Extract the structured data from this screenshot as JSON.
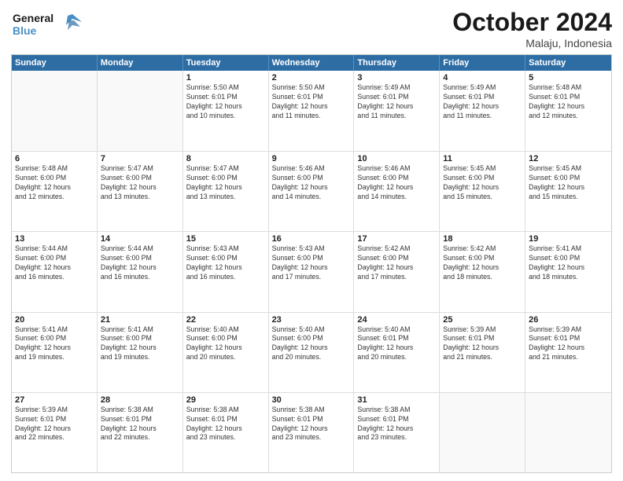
{
  "logo": {
    "line1": "General",
    "line2": "Blue"
  },
  "header": {
    "month": "October 2024",
    "location": "Malaju, Indonesia"
  },
  "days_of_week": [
    "Sunday",
    "Monday",
    "Tuesday",
    "Wednesday",
    "Thursday",
    "Friday",
    "Saturday"
  ],
  "weeks": [
    [
      {
        "day": "",
        "info": ""
      },
      {
        "day": "",
        "info": ""
      },
      {
        "day": "1",
        "info": "Sunrise: 5:50 AM\nSunset: 6:01 PM\nDaylight: 12 hours\nand 10 minutes."
      },
      {
        "day": "2",
        "info": "Sunrise: 5:50 AM\nSunset: 6:01 PM\nDaylight: 12 hours\nand 11 minutes."
      },
      {
        "day": "3",
        "info": "Sunrise: 5:49 AM\nSunset: 6:01 PM\nDaylight: 12 hours\nand 11 minutes."
      },
      {
        "day": "4",
        "info": "Sunrise: 5:49 AM\nSunset: 6:01 PM\nDaylight: 12 hours\nand 11 minutes."
      },
      {
        "day": "5",
        "info": "Sunrise: 5:48 AM\nSunset: 6:01 PM\nDaylight: 12 hours\nand 12 minutes."
      }
    ],
    [
      {
        "day": "6",
        "info": "Sunrise: 5:48 AM\nSunset: 6:00 PM\nDaylight: 12 hours\nand 12 minutes."
      },
      {
        "day": "7",
        "info": "Sunrise: 5:47 AM\nSunset: 6:00 PM\nDaylight: 12 hours\nand 13 minutes."
      },
      {
        "day": "8",
        "info": "Sunrise: 5:47 AM\nSunset: 6:00 PM\nDaylight: 12 hours\nand 13 minutes."
      },
      {
        "day": "9",
        "info": "Sunrise: 5:46 AM\nSunset: 6:00 PM\nDaylight: 12 hours\nand 14 minutes."
      },
      {
        "day": "10",
        "info": "Sunrise: 5:46 AM\nSunset: 6:00 PM\nDaylight: 12 hours\nand 14 minutes."
      },
      {
        "day": "11",
        "info": "Sunrise: 5:45 AM\nSunset: 6:00 PM\nDaylight: 12 hours\nand 15 minutes."
      },
      {
        "day": "12",
        "info": "Sunrise: 5:45 AM\nSunset: 6:00 PM\nDaylight: 12 hours\nand 15 minutes."
      }
    ],
    [
      {
        "day": "13",
        "info": "Sunrise: 5:44 AM\nSunset: 6:00 PM\nDaylight: 12 hours\nand 16 minutes."
      },
      {
        "day": "14",
        "info": "Sunrise: 5:44 AM\nSunset: 6:00 PM\nDaylight: 12 hours\nand 16 minutes."
      },
      {
        "day": "15",
        "info": "Sunrise: 5:43 AM\nSunset: 6:00 PM\nDaylight: 12 hours\nand 16 minutes."
      },
      {
        "day": "16",
        "info": "Sunrise: 5:43 AM\nSunset: 6:00 PM\nDaylight: 12 hours\nand 17 minutes."
      },
      {
        "day": "17",
        "info": "Sunrise: 5:42 AM\nSunset: 6:00 PM\nDaylight: 12 hours\nand 17 minutes."
      },
      {
        "day": "18",
        "info": "Sunrise: 5:42 AM\nSunset: 6:00 PM\nDaylight: 12 hours\nand 18 minutes."
      },
      {
        "day": "19",
        "info": "Sunrise: 5:41 AM\nSunset: 6:00 PM\nDaylight: 12 hours\nand 18 minutes."
      }
    ],
    [
      {
        "day": "20",
        "info": "Sunrise: 5:41 AM\nSunset: 6:00 PM\nDaylight: 12 hours\nand 19 minutes."
      },
      {
        "day": "21",
        "info": "Sunrise: 5:41 AM\nSunset: 6:00 PM\nDaylight: 12 hours\nand 19 minutes."
      },
      {
        "day": "22",
        "info": "Sunrise: 5:40 AM\nSunset: 6:00 PM\nDaylight: 12 hours\nand 20 minutes."
      },
      {
        "day": "23",
        "info": "Sunrise: 5:40 AM\nSunset: 6:00 PM\nDaylight: 12 hours\nand 20 minutes."
      },
      {
        "day": "24",
        "info": "Sunrise: 5:40 AM\nSunset: 6:01 PM\nDaylight: 12 hours\nand 20 minutes."
      },
      {
        "day": "25",
        "info": "Sunrise: 5:39 AM\nSunset: 6:01 PM\nDaylight: 12 hours\nand 21 minutes."
      },
      {
        "day": "26",
        "info": "Sunrise: 5:39 AM\nSunset: 6:01 PM\nDaylight: 12 hours\nand 21 minutes."
      }
    ],
    [
      {
        "day": "27",
        "info": "Sunrise: 5:39 AM\nSunset: 6:01 PM\nDaylight: 12 hours\nand 22 minutes."
      },
      {
        "day": "28",
        "info": "Sunrise: 5:38 AM\nSunset: 6:01 PM\nDaylight: 12 hours\nand 22 minutes."
      },
      {
        "day": "29",
        "info": "Sunrise: 5:38 AM\nSunset: 6:01 PM\nDaylight: 12 hours\nand 23 minutes."
      },
      {
        "day": "30",
        "info": "Sunrise: 5:38 AM\nSunset: 6:01 PM\nDaylight: 12 hours\nand 23 minutes."
      },
      {
        "day": "31",
        "info": "Sunrise: 5:38 AM\nSunset: 6:01 PM\nDaylight: 12 hours\nand 23 minutes."
      },
      {
        "day": "",
        "info": ""
      },
      {
        "day": "",
        "info": ""
      }
    ]
  ]
}
